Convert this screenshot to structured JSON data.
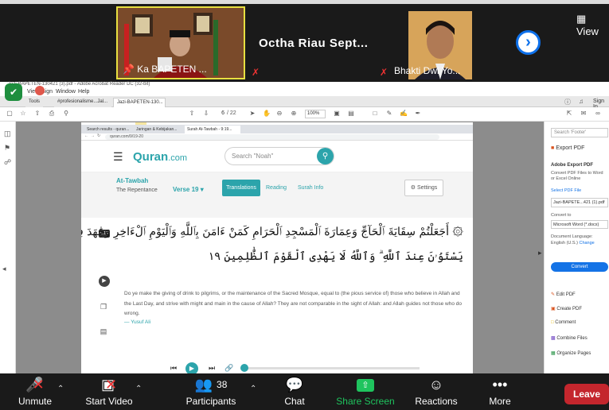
{
  "zoom": {
    "view_label": "View",
    "participants": [
      {
        "name": "Ka BAPETEN ..."
      },
      {
        "name": "Octha  Riau  Sept..."
      },
      {
        "name": "Bhakti Dwi Yo..."
      }
    ],
    "toolbar": {
      "unmute": "Unmute",
      "start_video": "Start Video",
      "participants": "Participants",
      "participants_count": "38",
      "chat": "Chat",
      "share_screen": "Share Screen",
      "reactions": "Reactions",
      "more": "More",
      "leave": "Leave"
    },
    "colors": {
      "share_green": "#1fc45e",
      "leave_red": "#c4262d",
      "zoom_blue": "#0e71eb"
    }
  },
  "acrobat": {
    "title": "Jazi-BAPETEN-130421 (3).pdf - Adobe Acrobat Reader DC (32-bit)",
    "menu": [
      "File",
      "Edit",
      "View",
      "Sign",
      "Window",
      "Help"
    ],
    "tabs": [
      "Tools",
      "#profesionalisme...Jal...",
      "Jazi-BAPETEN-130..."
    ],
    "page_current": "6",
    "page_total": "/ 22",
    "zoom": "100%",
    "sign_in": "Sign In",
    "right_pane": {
      "search": "Search 'Footer'",
      "export_pdf": "Export PDF",
      "export_heading": "Adobe Export PDF",
      "export_desc": "Convert PDF Files to Word or Excel Online",
      "select_file": "Select PDF File",
      "file_name": "Jazi-BAPETE...421 (1).pdf",
      "convert_to": "Convert to",
      "format": "Microsoft Word (*.docx)",
      "doc_lang": "Document Language:",
      "lang": "English (U.S.)",
      "change": "Change",
      "convert_btn": "Convert",
      "tools": [
        "Edit PDF",
        "Create PDF",
        "Comment",
        "Combine Files",
        "Organize Pages"
      ]
    }
  },
  "quran": {
    "browser_tabs": [
      "Search results - quran...",
      "Jaringan & Kebijakan...",
      "Surah At-Tawbah - 9:19..."
    ],
    "url": "quran.com/9/19-20",
    "logo_main": "Quran",
    "logo_suffix": ".com",
    "search_placeholder": "Search \"Noah\"",
    "surah": "At-Tawbah",
    "surah_sub": "The Repentance",
    "verse": "Verse 19",
    "tab_translations": "Translations",
    "tab_reading": "Reading",
    "tab_surah_info": "Surah Info",
    "settings": "Settings",
    "verse_number": "9:19",
    "arabic_line1": "۞ أَجَعَلْتُمْ سِقَايَةَ ٱلْحَآجِّ وَعِمَارَةَ ٱلْمَسْجِدِ ٱلْحَرَامِ كَمَنْ ءَامَنَ بِٱللَّهِ وَٱلْيَوْمِ ٱلْءَاخِرِ وَجَٰهَدَ فِى سَبِيلِ ٱللَّهِ ۚ لَا",
    "arabic_line2": "يَسْتَوُۥنَ عِندَ ٱللَّهِ ۗ وَٱللَّهُ لَا يَهْدِى ٱلْقَوْمَ ٱلظَّٰلِمِينَ ١٩",
    "translation": "Do ye make the giving of drink to pilgrims, or the maintenance of the Sacred Mosque, equal to (the pious service of) those who believe in Allah and the Last Day, and strive with might and main in the cause of Allah? They are not comparable in the sight of Allah: and Allah guides not those who do wrong.",
    "translator": "— Yusuf Ali",
    "teal": "#2ca4ab"
  }
}
